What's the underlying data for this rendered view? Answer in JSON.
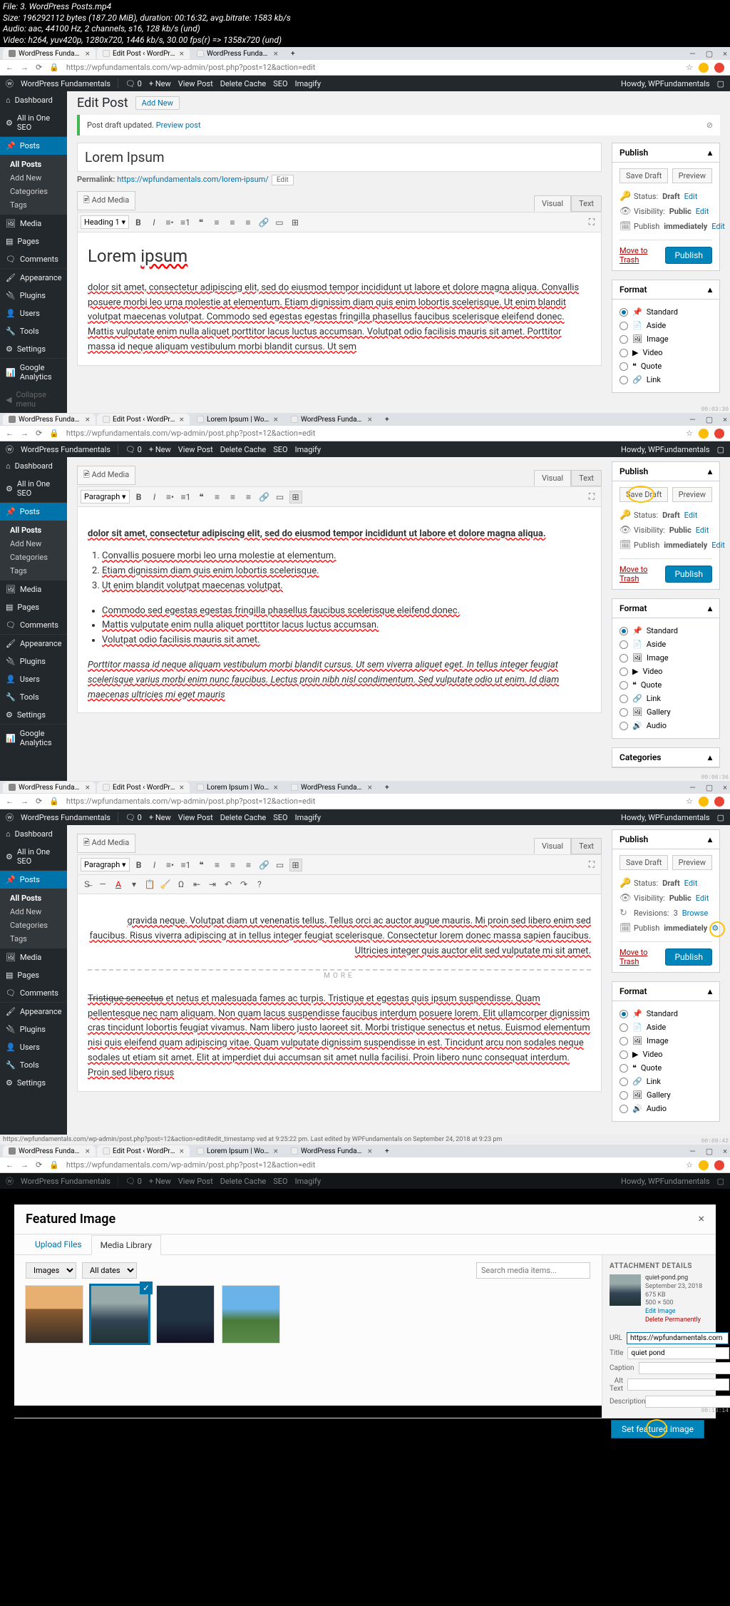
{
  "file_info": {
    "l1": "File: 3. WordPress Posts.mp4",
    "l2": "Size: 196292112 bytes (187.20 MiB), duration: 00:16:32, avg.bitrate: 1583 kb/s",
    "l3": "Audio: aac, 44100 Hz, 2 channels, s16, 128 kb/s (und)",
    "l4": "Video: h264, yuv420p, 1280x720, 1446 kb/s, 30.00 fps(r) => 1358x720 (und)"
  },
  "browser": {
    "tabs_f1": [
      "WordPress Fundamentals - Goo…",
      "Edit Post ‹ WordPress Fundame…",
      "WordPress Fundamentals | Lear…"
    ],
    "tabs_f2": [
      "WordPress Fundamentals - Goo…",
      "Edit Post ‹ WordPress Fundame…",
      "Lorem Ipsum | WordPress Funda…",
      "WordPress Fundamentals | Lear…"
    ],
    "url": "https://wpfundamentals.com/wp-admin/post.php?post=12&action=edit"
  },
  "wpbar": {
    "site": "WordPress Fundamentals",
    "comments": "0",
    "new": "+  New",
    "view": "View Post",
    "cache": "Delete Cache",
    "seo": "SEO",
    "imagify": "Imagify",
    "howdy": "Howdy, WPFundamentals"
  },
  "sidebar": {
    "dashboard": "Dashboard",
    "aioseo": "All in One SEO",
    "posts": "Posts",
    "all": "All Posts",
    "add": "Add New",
    "cats": "Categories",
    "tags": "Tags",
    "media": "Media",
    "pages": "Pages",
    "comments": "Comments",
    "appearance": "Appearance",
    "plugins": "Plugins",
    "users": "Users",
    "tools": "Tools",
    "settings": "Settings",
    "ga": "Google Analytics",
    "collapse": "Collapse menu"
  },
  "edit": {
    "title": "Edit Post",
    "add_new": "Add New",
    "notice": "Post draft updated.",
    "preview_post": "Preview post",
    "post_title": "Lorem Ipsum",
    "permalink_label": "Permalink:",
    "permalink_base": "https://wpfundamentals.com/",
    "permalink_slug": "lorem-ipsum/",
    "permalink_edit": "Edit",
    "add_media": "Add Media",
    "visual": "Visual",
    "text": "Text",
    "heading1": "Heading 1",
    "paragraph": "Paragraph"
  },
  "content_f1": {
    "h1a": "Lorem ",
    "h1b": "ipsum",
    "p1": "dolor sit amet, consectetur adipiscing elit, sed do eiusmod tempor incididunt ut labore et dolore magna aliqua. Convallis posuere morbi leo urna molestie at elementum. Etiam dignissim diam quis enim lobortis scelerisque. Ut enim blandit volutpat maecenas volutpat. Commodo sed egestas egestas fringilla phasellus faucibus scelerisque eleifend donec. Mattis vulputate enim nulla aliquet porttitor lacus luctus accumsan. Volutpat odio facilisis mauris sit amet. Porttitor massa id neque aliquam vestibulum morbi blandit cursus. Ut sem"
  },
  "content_f2": {
    "p1": "dolor sit amet, consectetur adipiscing elit, sed do eiusmod tempor incididunt ut labore et dolore magna aliqua.",
    "li1": "Convallis posuere morbi leo urna molestie at elementum.",
    "li2": "Etiam dignissim diam quis enim lobortis scelerisque.",
    "li3": "Ut enim blandit volutpat maecenas volutpat.",
    "b1": "Commodo sed egestas egestas fringilla phasellus faucibus scelerisque eleifend donec.",
    "b2": "Mattis vulputate enim nulla aliquet porttitor lacus luctus accumsan.",
    "b3": "Volutpat odio facilisis mauris sit amet.",
    "em": "Porttitor massa id neque aliquam vestibulum morbi blandit cursus. Ut sem viverra aliquet eget. In tellus integer feugiat scelerisque varius morbi enim nunc faucibus. Lectus proin nibh nisl condimentum. Sed vulputate odio ut enim. Id diam maecenas ultricies mi eget mauris"
  },
  "content_f3": {
    "p1": "gravida neque. Volutpat diam ut venenatis tellus. Tellus orci ac auctor augue mauris. Mi proin sed libero enim sed faucibus. Risus viverra adipiscing at in tellus integer feugiat scelerisque. Consectetur lorem donec massa sapien faucibus. Ultricies integer quis auctor elit sed vulputate mi sit amet.",
    "more": "MORE",
    "p2a": "Tristique senectus",
    "p2": " et netus et malesuada fames ac turpis. Tristique et egestas quis ipsum suspendisse. Quam pellentesque nec nam aliquam. Non quam lacus suspendisse faucibus interdum posuere lorem. Elit ullamcorper dignissim cras tincidunt lobortis feugiat vivamus. Nam libero justo laoreet sit. Morbi tristique senectus et netus. Euismod elementum nisi quis eleifend quam adipiscing vitae. Quam vulputate dignissim suspendisse in est. Tincidunt arcu non sodales neque sodales ut etiam sit amet. Elit at imperdiet dui accumsan sit amet nulla facilisi. Proin libero nunc consequat interdum. Proin sed libero risus"
  },
  "publish": {
    "title": "Publish",
    "save_draft": "Save Draft",
    "preview": "Preview",
    "status_label": "Status:",
    "status_val": "Draft",
    "vis_label": "Visibility:",
    "vis_val": "Public",
    "rev_label": "Revisions:",
    "rev_val": "3",
    "browse": "Browse",
    "pub_label": "Publish",
    "pub_val": "immediately",
    "edit": "Edit",
    "trash": "Move to Trash",
    "publish_btn": "Publish"
  },
  "format": {
    "title": "Format",
    "standard": "Standard",
    "aside": "Aside",
    "image": "Image",
    "video": "Video",
    "quote": "Quote",
    "link": "Link",
    "gallery": "Gallery",
    "audio": "Audio"
  },
  "categories": {
    "title": "Categories"
  },
  "footer_f3": "https://wpfundamentals.com/wp-admin/post.php?post=12&action=edit#edit_timestamp ved at 9:25:22 pm. Last edited by WPFundamentals on September 24, 2018 at 9:23 pm",
  "modal": {
    "title": "Featured Image",
    "upload": "Upload Files",
    "library": "Media Library",
    "images": "Images",
    "dates": "All dates",
    "search_ph": "Search media items...",
    "att_head": "ATTACHMENT DETAILS",
    "filename": "quiet-pond.png",
    "date": "September 23, 2018",
    "size": "675 KB",
    "dims": "500 × 500",
    "edit_img": "Edit Image",
    "del": "Delete Permanently",
    "url_label": "URL",
    "url_val": "https://wpfundamentals.com",
    "title_label": "Title",
    "title_val": "quiet pond",
    "cap_label": "Caption",
    "alt_label": "Alt Text",
    "desc_label": "Description",
    "set_btn": "Set featured image"
  },
  "timecodes": {
    "f1": "00:03:30",
    "f2": "00:06:36",
    "f3": "00:09:42",
    "f4": "00:13:14"
  }
}
